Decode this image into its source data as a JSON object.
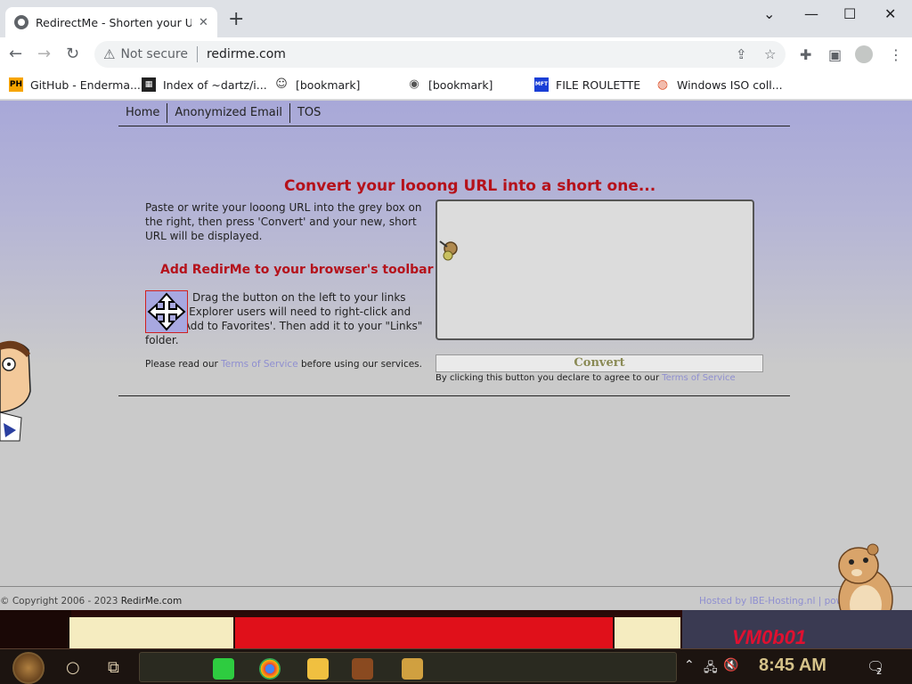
{
  "browser": {
    "tab_title": "RedirectMe - Shorten your URL",
    "tab_close": "✕",
    "new_tab": "+",
    "win_minimize": "⌄",
    "win_min": "—",
    "win_max": "☐",
    "win_close": "✕",
    "security_label": "Not secure",
    "url": "redirme.com"
  },
  "bookmarks": [
    {
      "icon": "PH",
      "label": "GitHub - Enderma...",
      "color": "#f7a500"
    },
    {
      "icon": "▦",
      "label": "Index of ~dartz/i...",
      "color": "#222222"
    },
    {
      "icon": "☺",
      "label": "[bookmark]",
      "color": "#555555"
    },
    {
      "icon": "◉",
      "label": "[bookmark]",
      "color": "#555555"
    },
    {
      "icon": "MFT",
      "label": "FILE ROULETTE",
      "color": "#1a3fd6"
    },
    {
      "icon": "◍",
      "label": "Windows ISO coll...",
      "color": "#de5833"
    }
  ],
  "nav": {
    "home": "Home",
    "email": "Anonymized Email",
    "tos": "TOS"
  },
  "main": {
    "headline": "Convert your looong URL into a short one...",
    "intro": "Paste or write your looong URL into the grey box on the right, then press 'Convert' and your new, short URL will be displayed.",
    "subhead": "Add RedirMe to your browser's toolbar",
    "drag_text": "Drag the button on the left to your links toolbar. Explorer users will need to right-click and select 'Add to Favorites'. Then add it to your \"Links\" folder.",
    "tos_prefix": "Please read our ",
    "tos_link": "Terms of Service",
    "tos_suffix": " before using our services.",
    "url_value": "",
    "convert_label": "Convert",
    "agree_prefix": "By clicking this button you declare to agree to our ",
    "agree_link": "Terms of Service"
  },
  "footer": {
    "copyright": "© Copyright 2006 - 2023 ",
    "site": "RedirMe.com",
    "hosted": "Hosted by IBE-Hosting.nl  |  pow"
  },
  "taskbar": {
    "clock": "8:45 AM",
    "notif_count": "2",
    "wallpaper_text": "VM0b01"
  },
  "colors": {
    "accent_red": "#b5121b",
    "link": "#8f8fd0"
  }
}
